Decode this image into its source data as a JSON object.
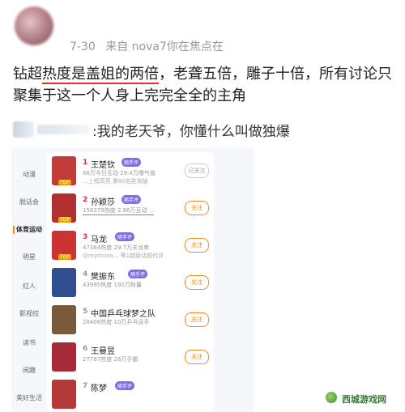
{
  "post": {
    "date": "7-30",
    "source": "来自 nova7你在焦点在",
    "text_parts": [
      "钻超",
      "热度是盖姐的两倍",
      "，老聋五倍，雕子十倍，所有讨论只聚集于这一个人身上完完全全的主角"
    ]
  },
  "comment": {
    "text": "我的老天爷，你懂什么叫做独爆"
  },
  "embedded": {
    "categories": [
      "动漫",
      "脱话会",
      "体育运动",
      "明星",
      "红人",
      "影视综",
      "读书",
      "闲趣",
      "美好生活"
    ],
    "active_category": "体育运动",
    "follow_label": "关注",
    "followed_label": "已关注",
    "top_tag": "TOP",
    "rows": [
      {
        "rank": "1",
        "name": "王楚钦",
        "badge": "随手评",
        "stats": "66万今日互动 29.4万爆气值",
        "sub": "...上榜高亮 第80名胜突破",
        "button": "已关注",
        "thumb_color": "#c43b3b"
      },
      {
        "rank": "2",
        "name": "孙颖莎",
        "badge": "随手评",
        "stats": "158379热度 2.86万互动 ...",
        "sub": "",
        "button": "关注",
        "thumb_color": "#b33030"
      },
      {
        "rank": "3",
        "name": "马龙",
        "badge": "随手评",
        "stats": "47364热度 29.7万关龙串",
        "sub": "@mymoon... 等1超级话题代评",
        "button": "关注",
        "thumb_color": "#cc3333"
      },
      {
        "rank": "4",
        "name": "樊振东",
        "badge": "随手评",
        "stats": "43995热度 190万粉量",
        "sub": "",
        "button": "关注",
        "thumb_color": "#2f4f8f"
      },
      {
        "rank": "5",
        "name": "中国乒乓球梦之队",
        "badge": "",
        "stats": "28406热度 10万乒乓运手",
        "sub": "",
        "button": "关注",
        "thumb_color": "#7a5a3a"
      },
      {
        "rank": "6",
        "name": "王曼昱",
        "badge": "",
        "stats": "27787热度 26万手霸",
        "sub": "",
        "button": "关注",
        "thumb_color": "#a62a3a"
      },
      {
        "rank": "7",
        "name": "陈梦",
        "badge": "随手评",
        "stats": "",
        "sub": "",
        "button": "",
        "thumb_color": "#b43a3a"
      }
    ]
  },
  "watermark": {
    "text": "西城游戏网"
  }
}
